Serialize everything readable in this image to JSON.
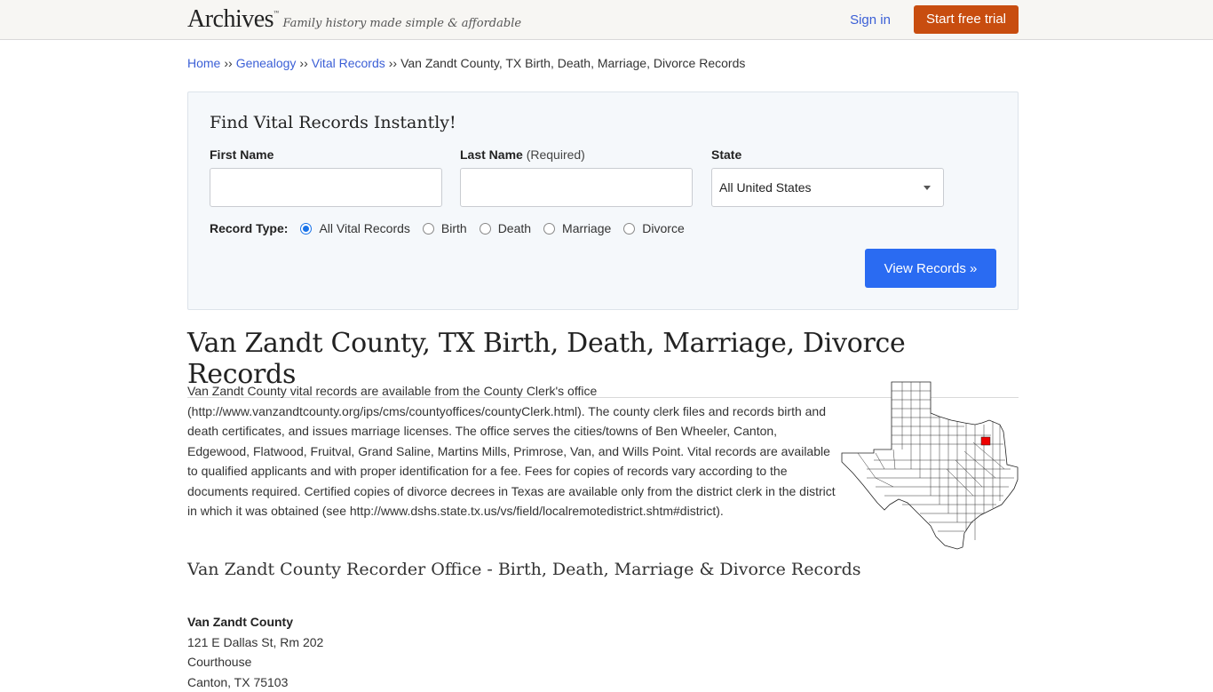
{
  "header": {
    "logo": "Archives",
    "logo_mark": "™",
    "tagline": "Family history made simple & affordable",
    "sign_in": "Sign in",
    "start_trial": "Start free trial"
  },
  "breadcrumb": {
    "items": [
      "Home",
      "Genealogy",
      "Vital Records"
    ],
    "separator": "››",
    "current": "Van Zandt County, TX Birth, Death, Marriage, Divorce Records"
  },
  "search": {
    "title": "Find Vital Records Instantly!",
    "first_name_label": "First Name",
    "first_name_value": "",
    "last_name_label": "Last Name",
    "last_name_required": "(Required)",
    "last_name_value": "",
    "state_label": "State",
    "state_value": "All United States",
    "record_type_label": "Record Type:",
    "record_types": [
      "All Vital Records",
      "Birth",
      "Death",
      "Marriage",
      "Divorce"
    ],
    "selected_record_type": "All Vital Records",
    "submit": "View Records »"
  },
  "page": {
    "title": "Van Zandt County, TX Birth, Death, Marriage, Divorce Records",
    "intro": "Van Zandt County vital records are available from the County Clerk's office (http://www.vanzandtcounty.org/ips/cms/countyoffices/countyClerk.html). The county clerk files and records birth and death certificates, and issues marriage licenses. The office serves the cities/towns of Ben Wheeler, Canton, Edgewood, Flatwood, Fruitval, Grand Saline, Martins Mills, Primrose, Van, and Wills Point. Vital records are available to qualified applicants and with proper identification for a fee. Fees for copies of records vary according to the documents required. Certified copies of divorce decrees in Texas are available only from the district clerk in the district in which it was obtained (see http://www.dshs.state.tx.us/vs/field/localremotedistrict.shtm#district).",
    "map_highlight_color": "#ee0000",
    "section_title": "Van Zandt County Recorder Office - Birth, Death, Marriage & Divorce Records",
    "office": {
      "name": "Van Zandt County",
      "address1": "121 E Dallas St, Rm 202",
      "address2": "Courthouse",
      "city_state_zip": "Canton, TX 75103"
    }
  }
}
